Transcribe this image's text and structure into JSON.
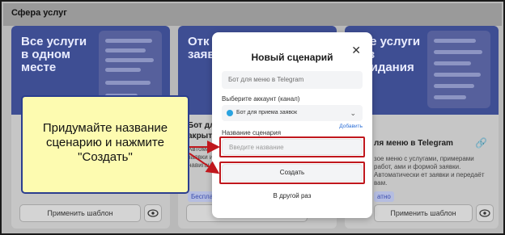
{
  "section_title": "Сфера услуг",
  "cards": [
    {
      "hero": "Все услуги в одном месте",
      "apply_label": "Применить шаблон",
      "eye_icon": "eye-icon"
    },
    {
      "hero": "Отк дост заяв",
      "body_title_partial": "Бот для",
      "body_line2_partial": "акрыт",
      "body_text_partial": "Автомат заявки и навигац",
      "badge_partial": "Бесплат",
      "apply_label": "Применить шаблон",
      "eye_icon": "eye-icon"
    },
    {
      "hero": "Все услуги без ожидания",
      "body_title": "ля меню в Telegram",
      "body_text": "зое меню с услугами, примерами работ, ами и формой заявки. Автоматически ет заявки и передаёт вам.",
      "badge": "атно",
      "apply_label": "Применить шаблон",
      "eye_icon": "eye-icon",
      "link_icon": "link-icon"
    }
  ],
  "modal": {
    "title": "Новый сценарий",
    "close_icon": "close-icon",
    "prefilled": "Бот для меню в Telegram",
    "account_label": "Выберите аккаунт (канал)",
    "account_value": "Бот для приема заявок",
    "add_link": "Добавить",
    "name_label": "Название сценария",
    "name_placeholder": "Введите название",
    "name_value": "",
    "create_label": "Создать",
    "later_label": "В другой раз"
  },
  "callout": {
    "text": "Придумайте название сценарию и нажмите \"Создать\""
  },
  "colors": {
    "highlight": "#c0171d",
    "callout_bg": "#fdfbb0",
    "callout_border": "#2b3e8f",
    "link": "#2b6ed6"
  }
}
